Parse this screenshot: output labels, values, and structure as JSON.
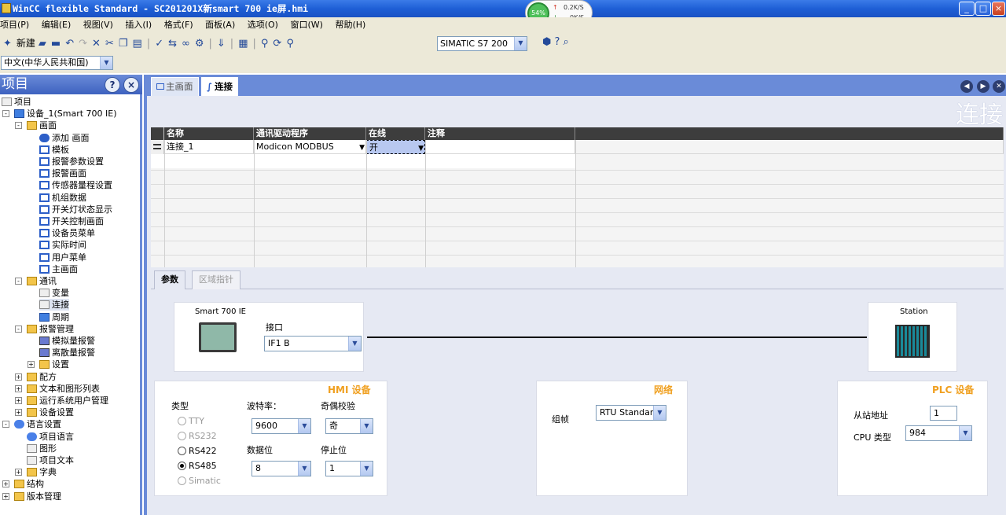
{
  "window": {
    "title": "WinCC flexible Standard - SC201201X新smart 700 ie屏.hmi",
    "net_percent": "54%",
    "net_up": "0.2K/S",
    "net_down": "0K/S",
    "buttons": [
      "_",
      "□",
      "×"
    ]
  },
  "menu": [
    "项目(P)",
    "编辑(E)",
    "视图(V)",
    "插入(I)",
    "格式(F)",
    "面板(A)",
    "选项(O)",
    "窗口(W)",
    "帮助(H)"
  ],
  "toolbar": {
    "new_label": "新建",
    "plc_select": "SIMATIC S7 200",
    "language_select": "中文(中华人民共和国)"
  },
  "project_panel": {
    "title": "项目",
    "help_btn": "?",
    "close_btn": "×",
    "tree": [
      {
        "label": "项目",
        "lv": 0,
        "icon": "ic-plain",
        "exp": ""
      },
      {
        "label": "设备_1(Smart 700 IE)",
        "lv": 1,
        "icon": "ic-dev",
        "exp": "-"
      },
      {
        "label": "画面",
        "lv": 2,
        "icon": "ic-folder",
        "exp": "-"
      },
      {
        "label": "添加 画面",
        "lv": 3,
        "icon": "ic-add",
        "exp": ""
      },
      {
        "label": "模板",
        "lv": 3,
        "icon": "ic-screen",
        "exp": ""
      },
      {
        "label": "报警参数设置",
        "lv": 3,
        "icon": "ic-screen",
        "exp": ""
      },
      {
        "label": "报警画面",
        "lv": 3,
        "icon": "ic-screen",
        "exp": ""
      },
      {
        "label": "传感器量程设置",
        "lv": 3,
        "icon": "ic-screen",
        "exp": ""
      },
      {
        "label": "机组数据",
        "lv": 3,
        "icon": "ic-screen",
        "exp": ""
      },
      {
        "label": "开关灯状态显示",
        "lv": 3,
        "icon": "ic-screen",
        "exp": ""
      },
      {
        "label": "开关控制画面",
        "lv": 3,
        "icon": "ic-screen",
        "exp": ""
      },
      {
        "label": "设备员菜单",
        "lv": 3,
        "icon": "ic-screen",
        "exp": ""
      },
      {
        "label": "实际时间",
        "lv": 3,
        "icon": "ic-screen",
        "exp": ""
      },
      {
        "label": "用户菜单",
        "lv": 3,
        "icon": "ic-screen",
        "exp": ""
      },
      {
        "label": "主画面",
        "lv": 3,
        "icon": "ic-screen",
        "exp": ""
      },
      {
        "label": "通讯",
        "lv": 2,
        "icon": "ic-folder",
        "exp": "-"
      },
      {
        "label": "变量",
        "lv": 3,
        "icon": "ic-plain",
        "exp": ""
      },
      {
        "label": "连接",
        "lv": 3,
        "icon": "ic-plain",
        "exp": ""
      },
      {
        "label": "周期",
        "lv": 3,
        "icon": "ic-dev",
        "exp": ""
      },
      {
        "label": "报警管理",
        "lv": 2,
        "icon": "ic-folder",
        "exp": "-"
      },
      {
        "label": "模拟量报警",
        "lv": 3,
        "icon": "ic-alarm",
        "exp": ""
      },
      {
        "label": "离散量报警",
        "lv": 3,
        "icon": "ic-alarm",
        "exp": ""
      },
      {
        "label": "设置",
        "lv": 3,
        "icon": "ic-folder",
        "exp": "+"
      },
      {
        "label": "配方",
        "lv": 2,
        "icon": "ic-folder",
        "exp": "+"
      },
      {
        "label": "文本和图形列表",
        "lv": 2,
        "icon": "ic-folder",
        "exp": "+"
      },
      {
        "label": "运行系统用户管理",
        "lv": 2,
        "icon": "ic-folder",
        "exp": "+"
      },
      {
        "label": "设备设置",
        "lv": 2,
        "icon": "ic-folder",
        "exp": "+"
      },
      {
        "label": "语言设置",
        "lv": 1,
        "icon": "ic-lang",
        "exp": "-"
      },
      {
        "label": "项目语言",
        "lv": 2,
        "icon": "ic-lang",
        "exp": ""
      },
      {
        "label": "图形",
        "lv": 2,
        "icon": "ic-plain",
        "exp": ""
      },
      {
        "label": "项目文本",
        "lv": 2,
        "icon": "ic-plain",
        "exp": ""
      },
      {
        "label": "字典",
        "lv": 2,
        "icon": "ic-folder",
        "exp": "+"
      },
      {
        "label": "结构",
        "lv": 1,
        "icon": "ic-folder",
        "exp": "+"
      },
      {
        "label": "版本管理",
        "lv": 1,
        "icon": "ic-folder",
        "exp": "+"
      }
    ]
  },
  "editor": {
    "tabs": [
      "主画面",
      "连接"
    ],
    "title": "连接",
    "columns": [
      "名称",
      "通讯驱动程序",
      "在线",
      "注释"
    ],
    "rows": [
      {
        "name": "连接_1",
        "driver": "Modicon MODBUS",
        "online": "开",
        "comment": ""
      }
    ],
    "param_tabs": [
      "参数",
      "区域指针"
    ]
  },
  "params": {
    "hmi_device": "Smart 700 IE",
    "interface_label": "接口",
    "interface_value": "IF1 B",
    "station_label": "Station",
    "hmi_header": "HMI 设备",
    "type_label": "类型",
    "types": [
      "TTY",
      "RS232",
      "RS422",
      "RS485",
      "Simatic"
    ],
    "baud_label": "波特率：",
    "baud_value": "9600",
    "parity_label": "奇偶校验",
    "parity_value": "奇",
    "databits_label": "数据位",
    "databits_value": "8",
    "stopbits_label": "停止位",
    "stopbits_value": "1",
    "network_header": "网络",
    "frame_label": "组帧",
    "frame_value": "RTU Standard",
    "plc_header": "PLC 设备",
    "slave_label": "从站地址",
    "slave_value": "1",
    "cpu_label": "CPU 类型",
    "cpu_value": "984"
  }
}
